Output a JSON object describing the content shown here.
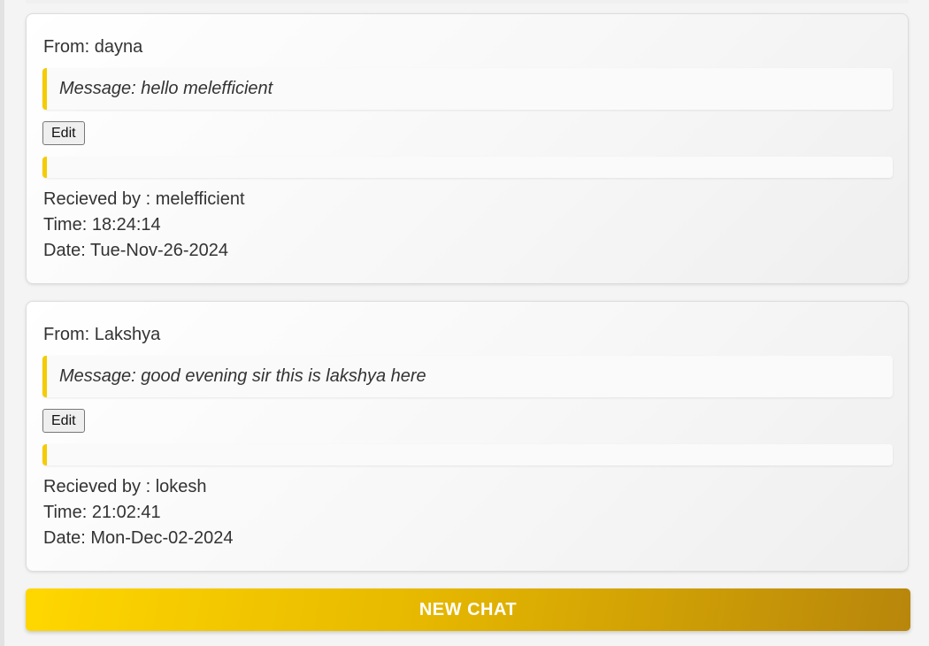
{
  "messages": [
    {
      "from_label": "From: dayna",
      "message_text": "Message: hello melefficient",
      "edit_label": "Edit",
      "received_by": "Recieved by : melefficient",
      "time": "Time: 18:24:14",
      "date": "Date: Tue-Nov-26-2024"
    },
    {
      "from_label": "From: Lakshya",
      "message_text": "Message: good evening sir this is lakshya here",
      "edit_label": "Edit",
      "received_by": "Recieved by : lokesh",
      "time": "Time: 21:02:41",
      "date": "Date: Mon-Dec-02-2024"
    }
  ],
  "new_chat_label": "NEW CHAT",
  "colors": {
    "accent": "#f5cc00",
    "button_gradient_start": "#ffd700",
    "button_gradient_end": "#b8860b"
  }
}
